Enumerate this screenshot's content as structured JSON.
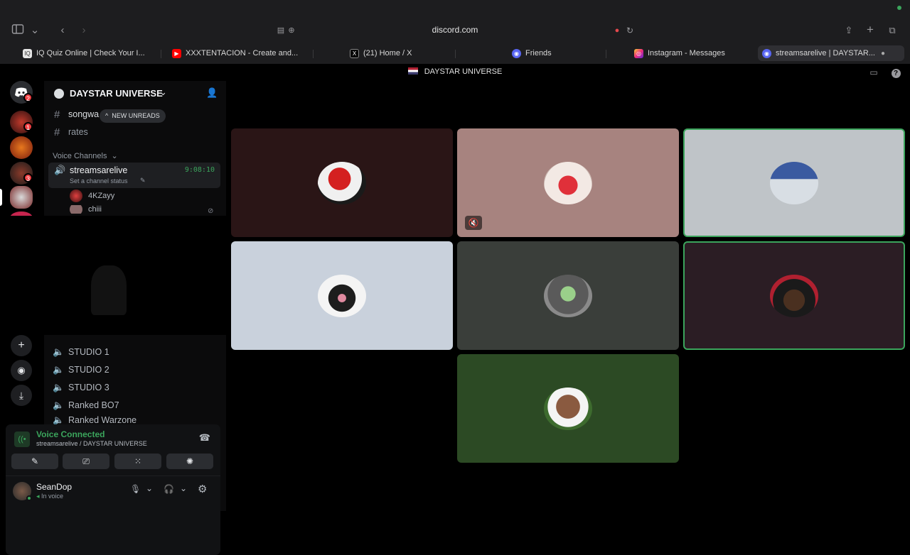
{
  "browser": {
    "url": "discord.com",
    "tabs": [
      {
        "label": "IQ Quiz Online | Check Your I...",
        "favicon": "iq-quiz-icon",
        "active": false
      },
      {
        "label": "XXXTENTACION - Create and...",
        "favicon": "youtube-icon",
        "active": false
      },
      {
        "label": "(21) Home / X",
        "favicon": "x-icon",
        "active": false
      },
      {
        "label": "Friends",
        "favicon": "discord-icon",
        "active": false
      },
      {
        "label": "Instagram - Messages",
        "favicon": "instagram-icon",
        "active": false
      },
      {
        "label": "streamsarelive | DAYSTAR...",
        "favicon": "discord-icon",
        "active": true
      }
    ]
  },
  "app": {
    "title": "DAYSTAR UNIVERSE"
  },
  "rail": {
    "badges": [
      "2",
      "1",
      "3"
    ]
  },
  "sidebar": {
    "server_name": "DAYSTAR UNIVERSE",
    "unread_pill": "NEW UNREADS",
    "text_channels": [
      "songwa",
      "rates"
    ],
    "voice_category": "Voice Channels",
    "active_voice": {
      "name": "streamsarelive",
      "timer": "9:08:10",
      "status_placeholder": "Set a channel status"
    },
    "members": [
      "4KZayy",
      "chiii"
    ],
    "voice_channels": [
      "STUDIO 1",
      "STUDIO 2",
      "STUDIO 3",
      "Ranked BO7",
      "Ranked Warzone"
    ]
  },
  "voice_panel": {
    "status": "Voice Connected",
    "location": "streamsarelive / DAYSTAR UNIVERSE"
  },
  "user": {
    "name": "SeanDop",
    "status": "In voice"
  },
  "stage": {
    "tiles": [
      {
        "bg": "#2a1516",
        "speaking": false,
        "muted": false
      },
      {
        "bg": "#a7837f",
        "speaking": false,
        "muted": true
      },
      {
        "bg": "#bfc4c8",
        "speaking": true,
        "muted": false
      },
      {
        "bg": "#c9d1dc",
        "speaking": false,
        "muted": false
      },
      {
        "bg": "#3a3e3a",
        "speaking": false,
        "muted": false
      },
      {
        "bg": "#2b1d24",
        "speaking": true,
        "muted": false
      },
      {
        "bg": "#2c4a24",
        "speaking": false,
        "muted": false
      }
    ]
  },
  "colors": {
    "accent_green": "#3ba55c",
    "badge_red": "#f23f43",
    "voice_connected": "#3ba55c"
  }
}
